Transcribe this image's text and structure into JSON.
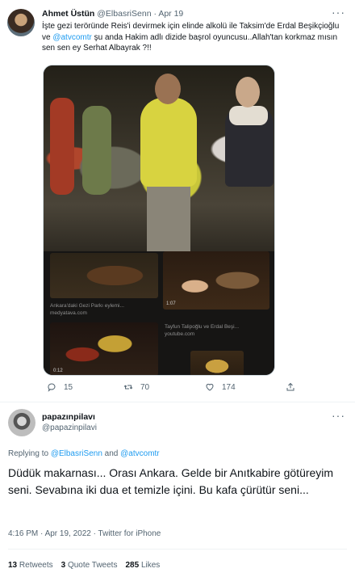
{
  "tweet": {
    "author_name": "Ahmet Üstün",
    "author_handle": "@ElbasriSenn",
    "separator": "·",
    "date": "Apr 19",
    "more": "···",
    "text_parts": {
      "p1": "İşte gezi teröründe Reis'i devirmek için elinde alkolü ile Taksim'de Erdal Beşikçioğlu ve ",
      "mention": "@atvcomtr",
      "p2": " şu anda Hakim adlı dizide başrol oyuncusu..Allah'tan korkmaz mısın sen sen ey Serhat Albayrak ?!!"
    },
    "media": {
      "thumb1_caption_title": "Ankara'daki Gezi Parkı eylemi...",
      "thumb1_caption_source": "medyatava.com",
      "thumb2_caption_title": "Tayfun Talipoğlu ve Erdal Beşi...",
      "thumb2_caption_source": "youtube.com",
      "thumb2_duration": "1:07",
      "thumb3_duration": "0:12"
    },
    "actions": {
      "reply_count": "15",
      "retweet_count": "70",
      "like_count": "174"
    }
  },
  "reply": {
    "author_name": "papazınpilavı",
    "author_handle": "@papazinpilavi",
    "more": "···",
    "replying_prefix": "Replying to ",
    "replying_user1": "@ElbasriSenn",
    "replying_and": " and ",
    "replying_user2": "@atvcomtr",
    "text": "Düdük makarnası... Orası Ankara. Gelde bir Anıtkabire götüreyim seni. Sevabına iki dua et temizle içini. Bu kafa çürütür seni...",
    "timestamp": "4:16 PM · Apr 19, 2022 · Twitter for iPhone",
    "stats": {
      "retweets_count": "13",
      "retweets_label": "Retweets",
      "quote_count": "3",
      "quote_label": "Quote Tweets",
      "likes_count": "285",
      "likes_label": "Likes"
    }
  },
  "colors": {
    "link": "#1d9bf0",
    "secondary_text": "#536471",
    "primary_text": "#0f1419"
  },
  "icons": [
    "reply-icon",
    "retweet-icon",
    "like-icon",
    "share-icon",
    "more-icon"
  ]
}
